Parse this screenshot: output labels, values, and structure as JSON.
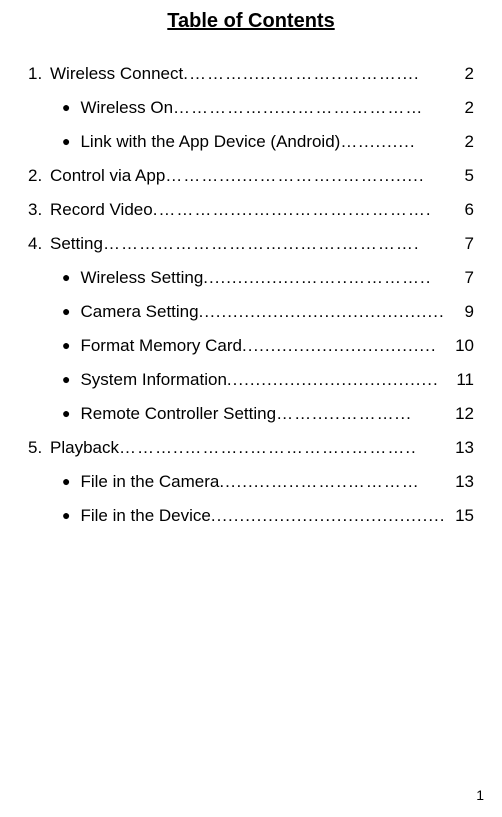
{
  "title": "Table of Contents",
  "page_number": "1",
  "entries": [
    {
      "type": "top",
      "num": "1.",
      "label": "Wireless Connect",
      "leader": ".………......………..………....",
      "page": "2"
    },
    {
      "type": "sub",
      "label": "Wireless On",
      "leader": "……………......…………………",
      "page": "2"
    },
    {
      "type": "sub",
      "label": "Link with the App Device (Android)",
      "leader": "…..........",
      "page": "2"
    },
    {
      "type": "top",
      "num": "2.",
      "label": "Control via App",
      "leader": "……….......…………..……........",
      "page": "5"
    },
    {
      "type": "top",
      "num": "3.",
      "label": "Record Video",
      "leader": ".…………....…....……….………….",
      "page": "6"
    },
    {
      "type": "top",
      "num": "4.",
      "label": "Setting",
      "leader": "…………………………...…….………….",
      "page": "7"
    },
    {
      "type": "sub",
      "label": "Wireless Setting",
      "leader": ".................……..…………..",
      "page": "7"
    },
    {
      "type": "sub",
      "label": "Camera Setting",
      "leader": "...........................................",
      "page": "9"
    },
    {
      "type": "sub",
      "label": "Format Memory Card",
      "leader": "..................................",
      "page": "10"
    },
    {
      "type": "sub",
      "label": "System Information",
      "leader": ".....................................",
      "page": "11"
    },
    {
      "type": "sub",
      "label": "Remote Controller Setting",
      "leader": "…….....………...",
      "page": "12"
    },
    {
      "type": "top",
      "num": "5.",
      "label": "Playback",
      "leader": "………..………..……………..………..",
      "page": "13"
    },
    {
      "type": "sub",
      "label": "File in the Camera",
      "leader": ".........…..……..…………",
      "page": "13"
    },
    {
      "type": "sub",
      "label": "File in the Device",
      "leader": ".........................................",
      "page": "15"
    }
  ]
}
